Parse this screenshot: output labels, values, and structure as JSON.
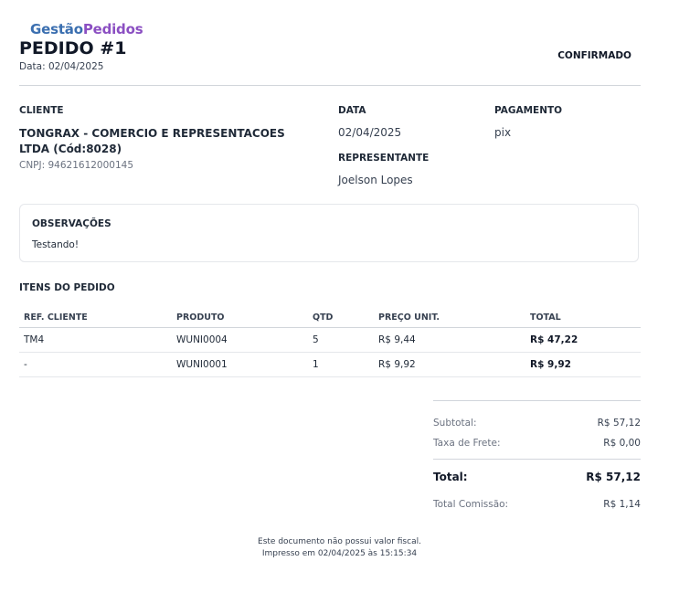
{
  "brand": {
    "part1": "Gestão",
    "part2": "Pedidos"
  },
  "order": {
    "title": "PEDIDO #1",
    "date_line": "Data: 02/04/2025",
    "status": "CONFIRMADO"
  },
  "client": {
    "label": "CLIENTE",
    "name": "TONGRAX - COMERCIO E REPRESENTACOES LTDA (Cód:8028)",
    "cnpj": "CNPJ: 94621612000145"
  },
  "date": {
    "label": "DATA",
    "value": "02/04/2025"
  },
  "payment": {
    "label": "PAGAMENTO",
    "value": "pix"
  },
  "representative": {
    "label": "REPRESENTANTE",
    "value": "Joelson Lopes"
  },
  "observations": {
    "label": "OBSERVAÇÕES",
    "text": "Testando!"
  },
  "items": {
    "title": "ITENS DO PEDIDO",
    "columns": [
      "REF. CLIENTE",
      "PRODUTO",
      "QTD",
      "PREÇO UNIT.",
      "TOTAL"
    ],
    "rows": [
      {
        "ref": "TM4",
        "product": "WUNI0004",
        "qty": "5",
        "unit_price": "R$ 9,44",
        "total": "R$ 47,22"
      },
      {
        "ref": "-",
        "product": "WUNI0001",
        "qty": "1",
        "unit_price": "R$ 9,92",
        "total": "R$ 9,92"
      }
    ]
  },
  "summary": {
    "subtotal_label": "Subtotal:",
    "subtotal_value": "R$ 57,12",
    "freight_label": "Taxa de Frete:",
    "freight_value": "R$ 0,00",
    "total_label": "Total:",
    "total_value": "R$ 57,12",
    "commission_label": "Total Comissão:",
    "commission_value": "R$ 1,14"
  },
  "footer": {
    "line1": "Este documento não possui valor fiscal.",
    "line2": "Impresso em 02/04/2025 às 15:15:34"
  }
}
